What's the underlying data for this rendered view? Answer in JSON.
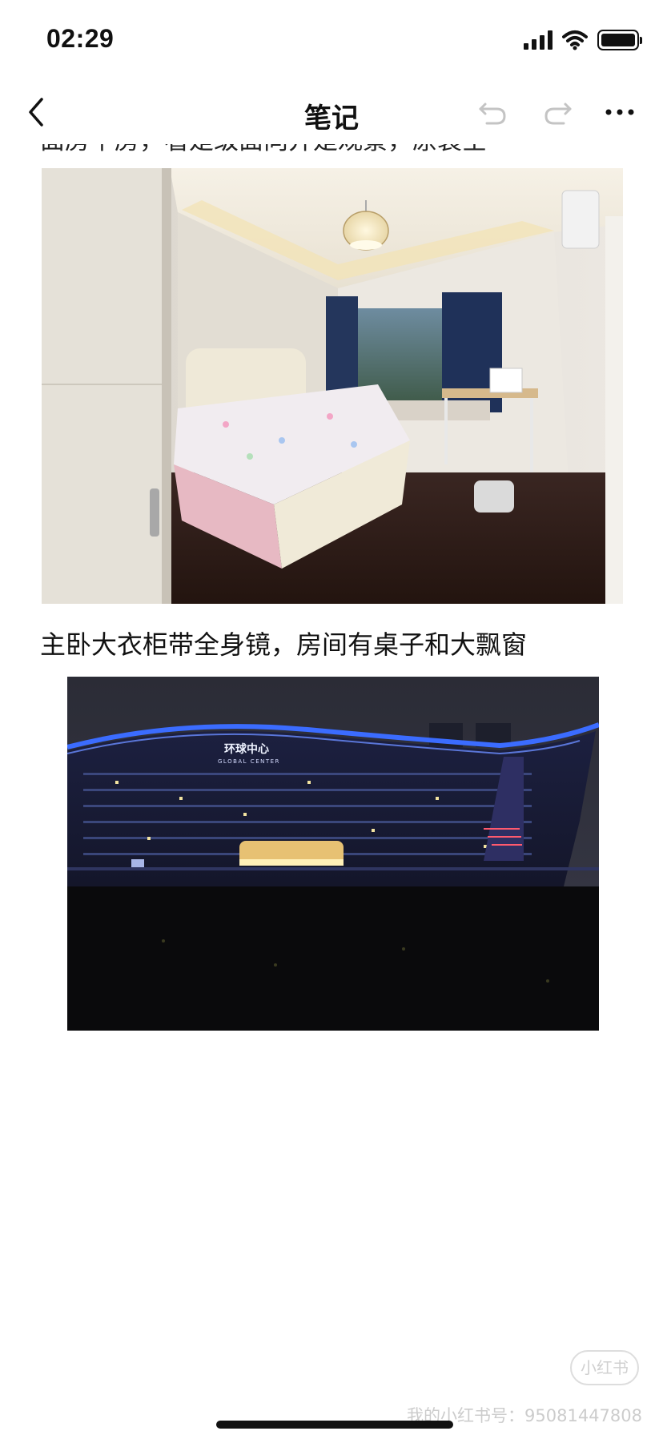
{
  "status_bar": {
    "time": "02:29",
    "icons": [
      "signal-icon",
      "wifi-icon",
      "battery-icon"
    ]
  },
  "nav": {
    "title": "笔记",
    "icons": [
      "back-chevron-icon",
      "undo-icon",
      "redo-icon",
      "more-icon"
    ]
  },
  "content": {
    "clipped_text": "面房中房，看是级面向并是观景，原装空",
    "photo_1": "bedroom-photo",
    "caption": "主卧大衣柜带全身镜，房间有桌子和大飘窗",
    "photo_2": "night-building-photo",
    "building_sign_cn": "环球中心",
    "building_sign_en": "GLOBAL CENTER"
  },
  "watermark": {
    "logo": "小红书",
    "text": "我的小红书号：95081447808"
  },
  "colors": {
    "text": "#111111",
    "background": "#ffffff",
    "watermark": "#aaaaaa",
    "neon": "#3b6cff"
  }
}
